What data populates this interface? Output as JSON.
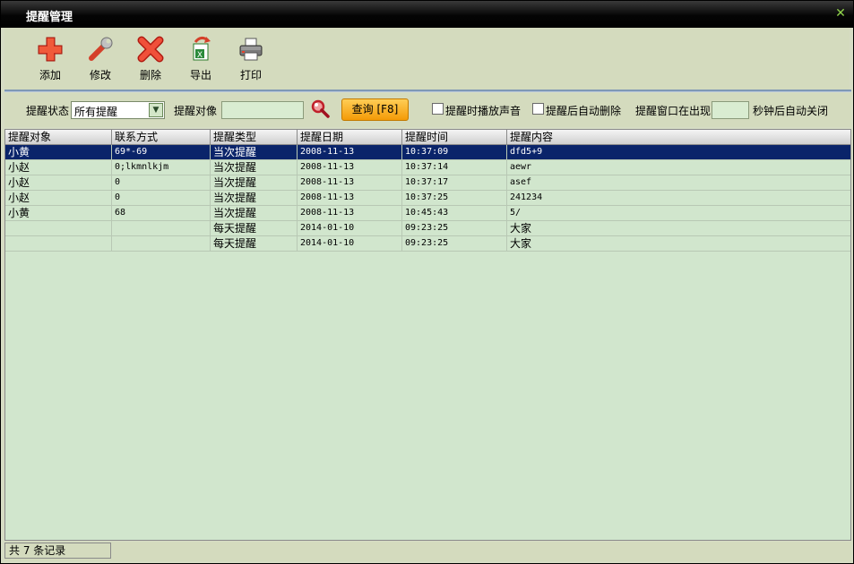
{
  "window": {
    "title": "提醒管理"
  },
  "toolbar": {
    "buttons": [
      {
        "label": "添加",
        "icon": "add-plus-icon"
      },
      {
        "label": "修改",
        "icon": "edit-wrench-icon"
      },
      {
        "label": "删除",
        "icon": "delete-x-icon"
      },
      {
        "label": "导出",
        "icon": "export-excel-icon"
      },
      {
        "label": "打印",
        "icon": "printer-icon"
      }
    ]
  },
  "filter": {
    "status_label": "提醒状态",
    "status_value": "所有提醒",
    "target_label": "提醒对像",
    "target_value": "",
    "query_button": "查询 [F8]",
    "play_sound_label": "提醒时播放声音",
    "auto_delete_label": "提醒后自动删除",
    "window_prefix": "提醒窗口在出现",
    "window_value": "",
    "window_suffix": "秒钟后自动关闭"
  },
  "grid": {
    "columns": [
      "提醒对象",
      "联系方式",
      "提醒类型",
      "提醒日期",
      "提醒时间",
      "提醒内容"
    ],
    "rows": [
      [
        "小黄",
        "69*-69",
        "当次提醒",
        "2008-11-13",
        "10:37:09",
        "dfd5+9"
      ],
      [
        "小赵",
        "0;lkmnlkjm",
        "当次提醒",
        "2008-11-13",
        "10:37:14",
        "aewr"
      ],
      [
        "小赵",
        "0",
        "当次提醒",
        "2008-11-13",
        "10:37:17",
        "asef"
      ],
      [
        "小赵",
        "0",
        "当次提醒",
        "2008-11-13",
        "10:37:25",
        "241234"
      ],
      [
        "小黄",
        "68",
        "当次提醒",
        "2008-11-13",
        "10:45:43",
        "5/"
      ],
      [
        "",
        "",
        "每天提醒",
        "2014-01-10",
        "09:23:25",
        "大家"
      ],
      [
        "",
        "",
        "每天提醒",
        "2014-01-10",
        "09:23:25",
        "大家"
      ]
    ],
    "selected_row": 0
  },
  "status": {
    "text": "共 7 条记录"
  },
  "colors": {
    "selected_row": "#0a246a",
    "grid_bg": "#d1e6cd",
    "query_button": "#f8b020"
  }
}
